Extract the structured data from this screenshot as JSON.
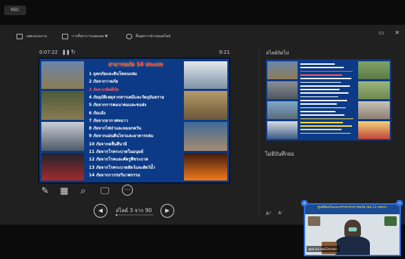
{
  "topbar": {
    "rec_label": "REC"
  },
  "toolbar": {
    "items": [
      {
        "label": "แสดงแถบงาน",
        "icon": "taskbar-icon"
      },
      {
        "label": "การตั้งค่าการแสดงผล ▼",
        "icon": "display-settings-icon"
      },
      {
        "label": "สิ้นสุดการนำเสนอสไลด์",
        "icon": "end-show-icon"
      }
    ],
    "window_controls": [
      "▭",
      "✕"
    ]
  },
  "presenter": {
    "timer": "0:07:22",
    "pause_icon": "❚❚",
    "reset_icon": "↻",
    "clock": "9:21"
  },
  "current_slide": {
    "title": "สาธารณภัย 14 ประเภท",
    "items": [
      "1  อุทกภัยและดินโคลนถล่ม",
      "2  ภัยจากวาตภัย",
      "3  ภัยจากอัคคีภัย",
      "4  ภัยอุบัติเหตุจากสารเคมีและวัตถุอันตราย",
      "5  ภัยจากการคมนาคมและขนส่ง",
      "6  ภัยแล้ง",
      "7  ภัยจากอากาศหนาว",
      "8  ภัยจากไฟป่าและหมอกควัน",
      "9  ภัยจากแผ่นดินไหวและอาคารถล่ม",
      "10  ภัยจากคลื่นสึนามิ",
      "11  ภัยจากโรคระบาดในมนุษย์",
      "12  ภัยจากโรคและศัตรูพืชระบาด",
      "13  ภัยจากโรคระบาดสัตว์และสัตว์น้ำ",
      "14  ภัยจากการก่อวินาศกรรม"
    ],
    "highlight_index": 2
  },
  "tools": {
    "pen": "✎",
    "slides_grid": "▦",
    "zoom": "⌕",
    "screen": "🖵",
    "more": "⋯"
  },
  "navigation": {
    "prev": "◀",
    "next": "▶",
    "counter": "สไลด์ 3 จาก 90",
    "current": 3,
    "total": 90
  },
  "right_panel": {
    "next_label": "สไลด์ถัดไป",
    "notes_empty": "ไม่มีบันทึกย่อ",
    "font_increase": "A⁺",
    "font_decrease": "A⁻"
  },
  "webcam": {
    "banner": "ศูนย์ป้องกันและบรรเทาสาธารณภัย เขต 12 สงขลา",
    "name": "ศูนย์ ปภ.เขต12สงขลา",
    "corner_left": "+",
    "corner_right": "−"
  },
  "colors": {
    "slide_bg": "#0c3a86",
    "title_red": "#ff3030",
    "highlight": "#ff5c5c",
    "accent_blue": "#2f6fe2"
  }
}
